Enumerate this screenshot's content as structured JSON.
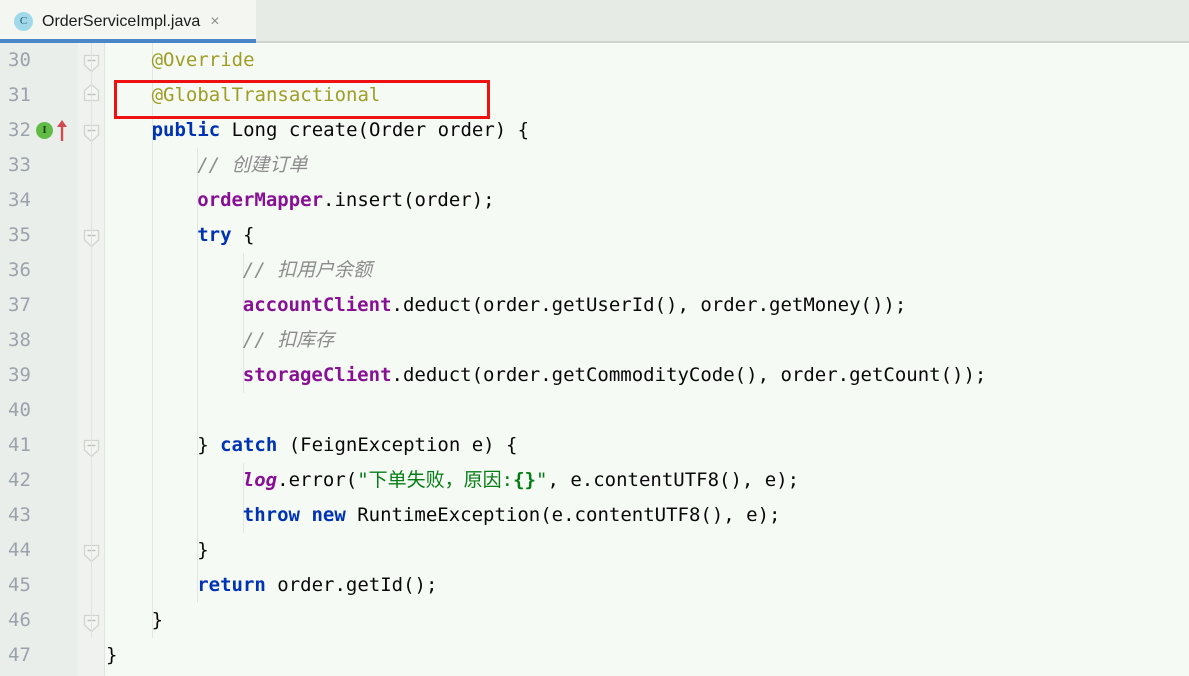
{
  "window": {
    "app": "IntelliJ IDEA code editor",
    "accent_blue": "#4a86c8",
    "editor_background": "#f6faf5",
    "gutter_background": "#eaeeea"
  },
  "tabbar": {
    "tabs": [
      {
        "label": "OrderServiceImpl.java",
        "icon": "java-class-icon",
        "icon_letter": "C",
        "close_label": "×",
        "active": true
      }
    ]
  },
  "annotation": {
    "type": "rectangle-highlight",
    "color": "#ee1111",
    "target_line": 31,
    "target_text": "@GlobalTransactional"
  },
  "gutter": {
    "icons": [
      {
        "line": 32,
        "name": "implementing-method-icon",
        "letter": "I",
        "color": "#62bb46"
      },
      {
        "line": 32,
        "name": "overriding-method-arrow-icon",
        "color": "#d04a52"
      }
    ],
    "fold_marker_lines": [
      30,
      31,
      32,
      35,
      41,
      44,
      46
    ]
  },
  "editor": {
    "first_line": 30,
    "last_line": 47,
    "lines": [
      {
        "num": "30",
        "indent": 4,
        "tokens": [
          {
            "t": "@Override",
            "c": "ann"
          }
        ]
      },
      {
        "num": "31",
        "indent": 4,
        "tokens": [
          {
            "t": "@GlobalTransactional",
            "c": "ann"
          }
        ]
      },
      {
        "num": "32",
        "indent": 4,
        "tokens": [
          {
            "t": "public",
            "c": "kw"
          },
          {
            "t": " Long create(Order order) {",
            "c": "plain"
          }
        ]
      },
      {
        "num": "33",
        "indent": 8,
        "tokens": [
          {
            "t": "// 创建订单",
            "c": "cmt"
          }
        ]
      },
      {
        "num": "34",
        "indent": 8,
        "tokens": [
          {
            "t": "orderMapper",
            "c": "fld"
          },
          {
            "t": ".insert(order);",
            "c": "plain"
          }
        ]
      },
      {
        "num": "35",
        "indent": 8,
        "tokens": [
          {
            "t": "try",
            "c": "kw"
          },
          {
            "t": " {",
            "c": "plain"
          }
        ]
      },
      {
        "num": "36",
        "indent": 12,
        "tokens": [
          {
            "t": "// 扣用户余额",
            "c": "cmt"
          }
        ]
      },
      {
        "num": "37",
        "indent": 12,
        "tokens": [
          {
            "t": "accountClient",
            "c": "fld"
          },
          {
            "t": ".deduct(order.getUserId(), order.getMoney());",
            "c": "plain"
          }
        ]
      },
      {
        "num": "38",
        "indent": 12,
        "tokens": [
          {
            "t": "// 扣库存",
            "c": "cmt"
          }
        ]
      },
      {
        "num": "39",
        "indent": 12,
        "tokens": [
          {
            "t": "storageClient",
            "c": "fld"
          },
          {
            "t": ".deduct(order.getCommodityCode(), order.getCount());",
            "c": "plain"
          }
        ]
      },
      {
        "num": "40",
        "indent": 0,
        "tokens": []
      },
      {
        "num": "41",
        "indent": 8,
        "tokens": [
          {
            "t": "} ",
            "c": "plain"
          },
          {
            "t": "catch",
            "c": "kw"
          },
          {
            "t": " (FeignException e) {",
            "c": "plain"
          }
        ]
      },
      {
        "num": "42",
        "indent": 12,
        "tokens": [
          {
            "t": "log",
            "c": "sfld"
          },
          {
            "t": ".error(",
            "c": "plain"
          },
          {
            "t": "\"下单失败，原因:",
            "c": "str"
          },
          {
            "t": "{}",
            "c": "strb"
          },
          {
            "t": "\"",
            "c": "str"
          },
          {
            "t": ", e.contentUTF8(), e);",
            "c": "plain"
          }
        ]
      },
      {
        "num": "43",
        "indent": 12,
        "tokens": [
          {
            "t": "throw",
            "c": "kw"
          },
          {
            "t": " ",
            "c": "plain"
          },
          {
            "t": "new",
            "c": "kw"
          },
          {
            "t": " RuntimeException(e.contentUTF8(), e);",
            "c": "plain"
          }
        ]
      },
      {
        "num": "44",
        "indent": 8,
        "tokens": [
          {
            "t": "}",
            "c": "plain"
          }
        ]
      },
      {
        "num": "45",
        "indent": 8,
        "tokens": [
          {
            "t": "return",
            "c": "kw"
          },
          {
            "t": " order.getId();",
            "c": "plain"
          }
        ]
      },
      {
        "num": "46",
        "indent": 4,
        "tokens": [
          {
            "t": "}",
            "c": "plain"
          }
        ]
      },
      {
        "num": "47",
        "indent": 0,
        "tokens": [
          {
            "t": "}",
            "c": "plain"
          }
        ]
      }
    ]
  }
}
